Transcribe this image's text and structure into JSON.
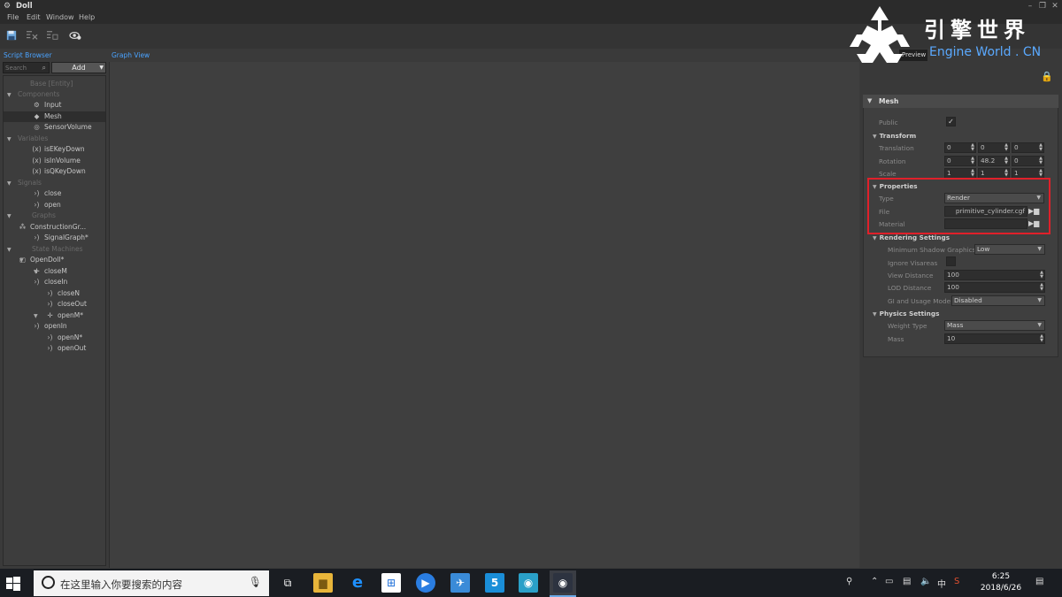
{
  "window": {
    "title": "Doll"
  },
  "menu": [
    "File",
    "Edit",
    "Window",
    "Help"
  ],
  "script_browser": {
    "label": "Script Browser",
    "search_placeholder": "Search",
    "add_label": "Add",
    "tree": [
      {
        "label": "Base [Entity]",
        "dim": true
      },
      {
        "label": "Components",
        "dim": true,
        "section": true
      },
      {
        "label": "Input",
        "icon": "input-icon"
      },
      {
        "label": "Mesh",
        "icon": "mesh-icon",
        "selected": true
      },
      {
        "label": "SensorVolume",
        "icon": "sensor-volume-icon"
      },
      {
        "label": "Variables",
        "dim": true,
        "section": true
      },
      {
        "label": "isEKeyDown",
        "icon": "variable-icon"
      },
      {
        "label": "isInVolume",
        "icon": "variable-icon"
      },
      {
        "label": "isQKeyDown",
        "icon": "variable-icon"
      },
      {
        "label": "Signals",
        "dim": true,
        "section": true
      },
      {
        "label": "close",
        "icon": "signal-icon"
      },
      {
        "label": "open",
        "icon": "signal-icon"
      },
      {
        "label": "Graphs",
        "dim": true,
        "section": true
      },
      {
        "label": "ConstructionGr...",
        "icon": "graph-icon"
      },
      {
        "label": "SignalGraph*",
        "icon": "signal-graph-icon"
      },
      {
        "label": "State Machines",
        "dim": true,
        "section": true
      },
      {
        "label": "OpenDoll*",
        "icon": "state-machine-icon"
      },
      {
        "label": "closeM",
        "icon": "state-icon"
      },
      {
        "label": "closeIn",
        "icon": "signal-icon"
      },
      {
        "label": "closeN",
        "icon": "signal-icon"
      },
      {
        "label": "closeOut",
        "icon": "signal-icon"
      },
      {
        "label": "openM*",
        "icon": "state-icon"
      },
      {
        "label": "openIn",
        "icon": "signal-icon"
      },
      {
        "label": "openN*",
        "icon": "signal-icon"
      },
      {
        "label": "openOut",
        "icon": "signal-icon"
      }
    ]
  },
  "graph_view": {
    "label": "Graph View"
  },
  "preview_tab": "Preview",
  "inspector": {
    "header": "Mesh",
    "public_label": "Public",
    "public_checked": true,
    "transform": {
      "title": "Transform",
      "translation_label": "Translation",
      "translation": [
        "0",
        "0",
        "0"
      ],
      "rotation_label": "Rotation",
      "rotation": [
        "0",
        "48.2",
        "0"
      ],
      "scale_label": "Scale",
      "scale": [
        "1",
        "1",
        "1"
      ]
    },
    "properties": {
      "title": "Properties",
      "type_label": "Type",
      "type_value": "Render",
      "file_label": "File",
      "file_value": "primitive_cylinder.cgf",
      "material_label": "Material",
      "material_value": ""
    },
    "rendering": {
      "title": "Rendering Settings",
      "min_shadow_label": "Minimum Shadow Graphics",
      "min_shadow_value": "Low",
      "ignore_visareas_label": "Ignore Visareas",
      "view_distance_label": "View Distance",
      "view_distance_value": "100",
      "lod_distance_label": "LOD Distance",
      "lod_distance_value": "100",
      "gi_label": "GI and Usage Mode",
      "gi_value": "Disabled"
    },
    "physics": {
      "title": "Physics Settings",
      "weight_type_label": "Weight Type",
      "weight_type_value": "Mass",
      "mass_label": "Mass",
      "mass_value": "10"
    }
  },
  "watermark": {
    "cn": "引擎世界",
    "en": "Engine World . CN"
  },
  "taskbar": {
    "search_placeholder": "在这里输入你要搜索的内容",
    "ime": "中",
    "time": "6:25",
    "date": "2018/6/26"
  },
  "colors": {
    "accent": "#4aa3ff",
    "highlight": "#e0202a",
    "taskbar": "#1a1d22"
  }
}
